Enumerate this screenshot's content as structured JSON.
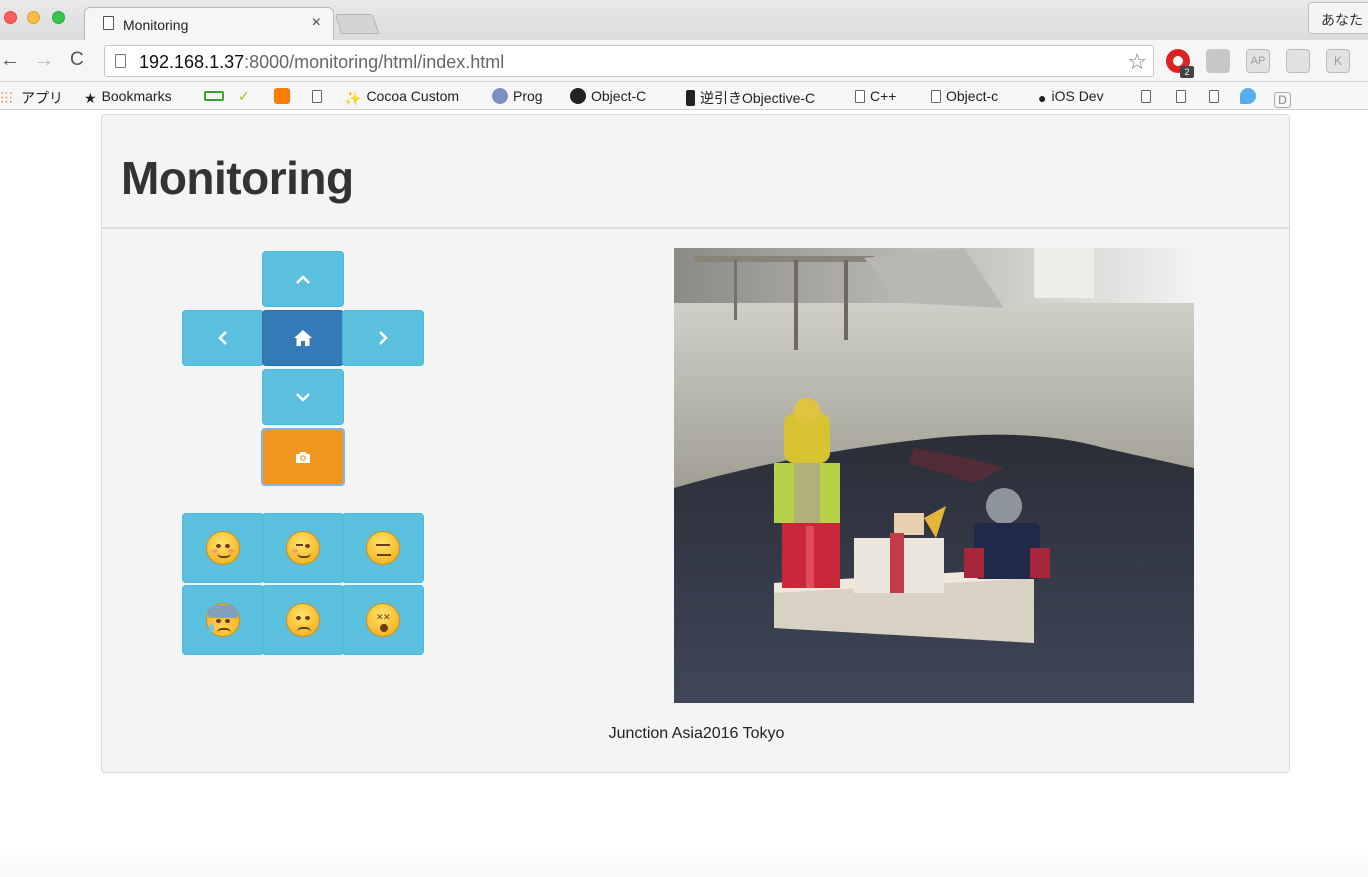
{
  "browser": {
    "tab_title": "Monitoring",
    "tab_close": "×",
    "profile_label": "あなた",
    "url_host": "192.168.1.37",
    "url_rest": ":8000/monitoring/html/index.html",
    "ext_badge": "2",
    "ext3_label": "AP",
    "ext5_label": "K",
    "bookmarks": [
      {
        "label": "アプリ",
        "icon": "apps-grid-icon"
      },
      {
        "label": "Bookmarks",
        "icon": "star-icon"
      },
      {
        "label": "",
        "icon": "battery-icon"
      },
      {
        "label": "",
        "icon": "bird-icon"
      },
      {
        "label": "",
        "icon": "blogger-icon"
      },
      {
        "label": "",
        "icon": "page-icon"
      },
      {
        "label": "Cocoa Custom",
        "icon": "cocoa-icon"
      },
      {
        "label": "Prog",
        "icon": "octocat-face-icon"
      },
      {
        "label": "Object-C",
        "icon": "github-icon"
      },
      {
        "label": "逆引きObjective-C",
        "icon": "phone-icon"
      },
      {
        "label": "C++",
        "icon": "page-icon"
      },
      {
        "label": "Object-c",
        "icon": "page-icon"
      },
      {
        "label": "iOS Dev",
        "icon": "apple-icon"
      },
      {
        "label": "",
        "icon": "page-icon"
      },
      {
        "label": "",
        "icon": "page-icon"
      },
      {
        "label": "",
        "icon": "page-icon"
      },
      {
        "label": "",
        "icon": "twitter-icon"
      },
      {
        "label": "D",
        "icon": "d-icon"
      }
    ]
  },
  "page": {
    "title": "Monitoring",
    "footer": "Junction Asia2016 Tokyo"
  },
  "controls": {
    "up": "chevron-up-icon",
    "left": "chevron-left-icon",
    "home": "home-icon",
    "right": "chevron-right-icon",
    "down": "chevron-down-icon",
    "camera": "camera-icon"
  },
  "emotions": [
    "smile",
    "wink",
    "expressionless",
    "fearful-sweat",
    "frowning",
    "dizzy"
  ],
  "colors": {
    "control_blue": "#5bc0de",
    "home_blue": "#337ab7",
    "camera_orange": "#f0961f"
  }
}
